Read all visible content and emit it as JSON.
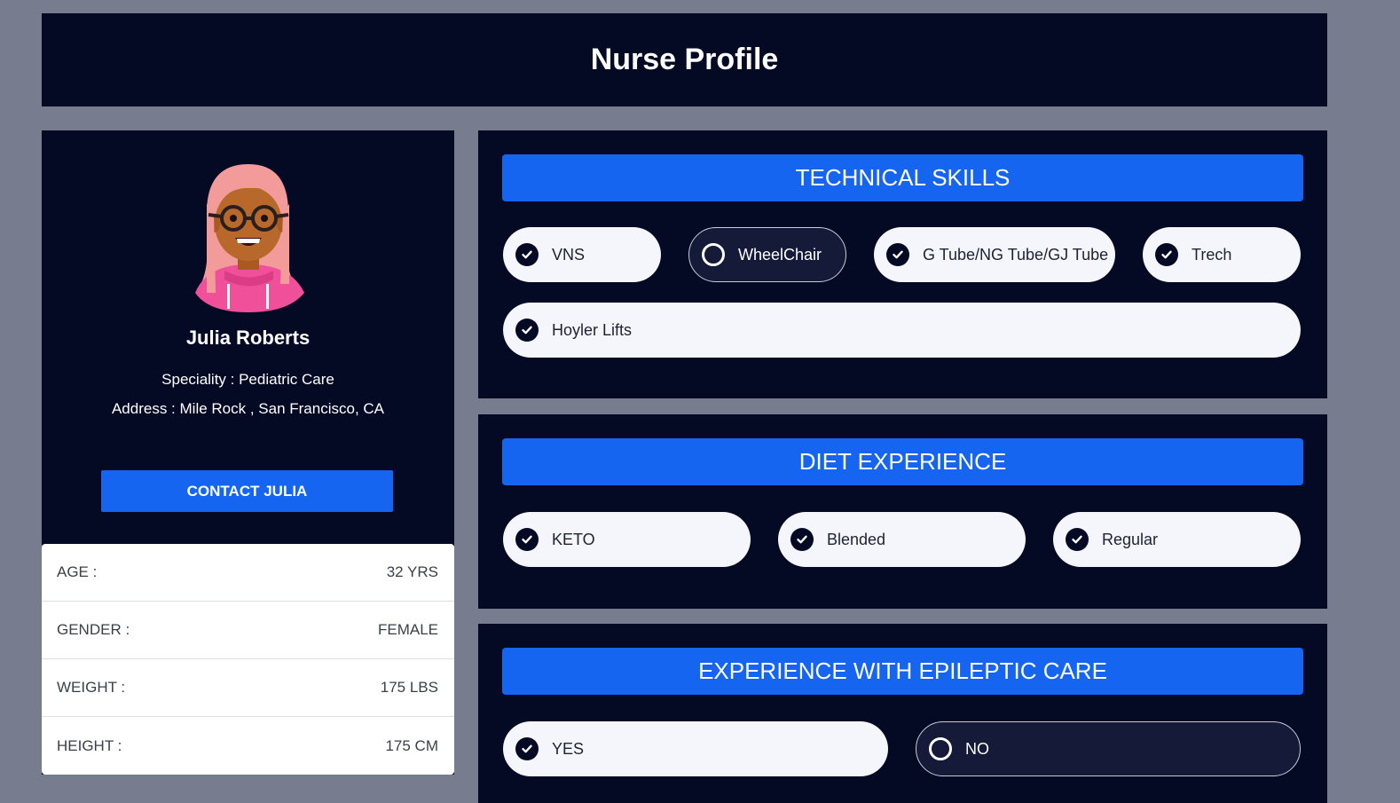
{
  "header": {
    "title": "Nurse Profile"
  },
  "profile": {
    "name": "Julia Roberts",
    "speciality": "Speciality : Pediatric Care",
    "address": "Address : Mile Rock , San Francisco, CA",
    "contact_button": "CONTACT JULIA",
    "stats": [
      {
        "label": "AGE :",
        "value": "32 YRS"
      },
      {
        "label": "GENDER :",
        "value": "FEMALE"
      },
      {
        "label": "WEIGHT :",
        "value": "175 LBS"
      },
      {
        "label": "HEIGHT :",
        "value": "175 CM"
      }
    ]
  },
  "technical_skills": {
    "title": "TECHNICAL SKILLS",
    "items": [
      {
        "label": "VNS",
        "checked": true
      },
      {
        "label": "WheelChair",
        "checked": false
      },
      {
        "label": "G Tube/NG Tube/GJ Tube",
        "checked": true
      },
      {
        "label": "Trech",
        "checked": true
      },
      {
        "label": "Hoyler Lifts",
        "checked": true
      }
    ]
  },
  "diet_experience": {
    "title": "DIET EXPERIENCE",
    "items": [
      {
        "label": "KETO",
        "checked": true
      },
      {
        "label": "Blended",
        "checked": true
      },
      {
        "label": "Regular",
        "checked": true
      }
    ]
  },
  "epileptic_care": {
    "title": "EXPERIENCE WITH EPILEPTIC CARE",
    "items": [
      {
        "label": "YES",
        "checked": true
      },
      {
        "label": "NO",
        "checked": false
      }
    ]
  },
  "colors": {
    "page_background": "#777c8f",
    "panel": "#050a24",
    "accent": "#1565f0",
    "chip_checked": "#f4f6fb",
    "chip_unchecked": "#141a37"
  },
  "icons": {
    "checked": "check-circle-icon",
    "unchecked": "empty-circle-icon"
  }
}
